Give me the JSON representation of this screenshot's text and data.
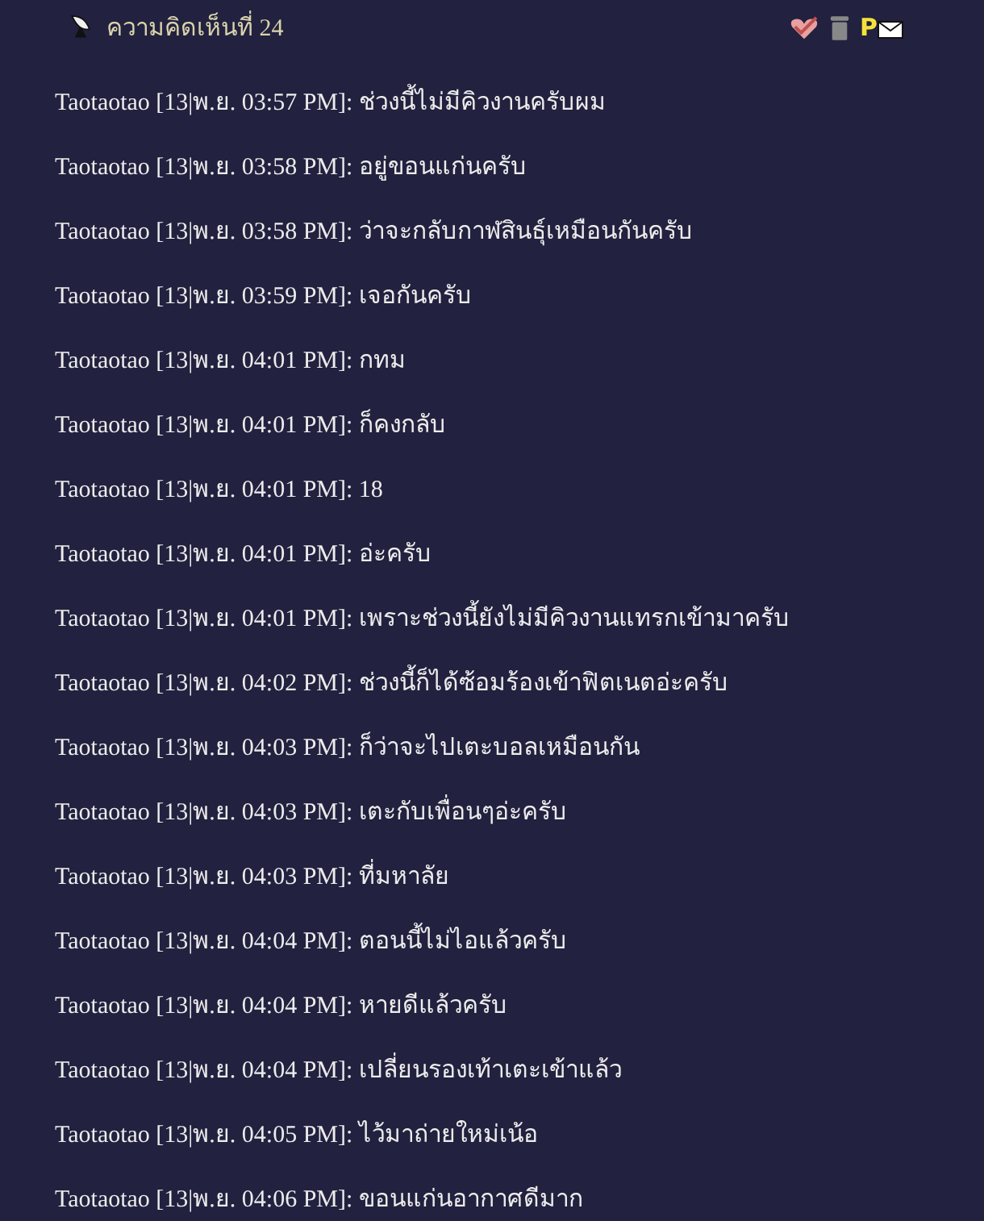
{
  "header": {
    "title": "ความคิดเห็นที่ 24",
    "pm_letter": "P"
  },
  "messages": [
    "Taotaotao [13|พ.ย. 03:57 PM]: ช่วงนี้ไม่มีคิวงานครับผม",
    "Taotaotao [13|พ.ย. 03:58 PM]: อยู่ขอนแก่นครับ",
    "Taotaotao [13|พ.ย. 03:58 PM]: ว่าจะกลับกาฬสินธุ์เหมือนกันครับ",
    "Taotaotao [13|พ.ย. 03:59 PM]: เจอกันครับ",
    "Taotaotao [13|พ.ย. 04:01 PM]: กทม",
    "Taotaotao [13|พ.ย. 04:01 PM]: ก็คงกลับ",
    "Taotaotao [13|พ.ย. 04:01 PM]: 18",
    "Taotaotao [13|พ.ย. 04:01 PM]: อ่ะครับ",
    "Taotaotao [13|พ.ย. 04:01 PM]: เพราะช่วงนี้ยังไม่มีคิวงานแทรกเข้ามาครับ",
    "Taotaotao [13|พ.ย. 04:02 PM]: ช่วงนี้ก็ได้ซ้อมร้องเข้าฟิตเนตอ่ะครับ",
    "Taotaotao [13|พ.ย. 04:03 PM]: ก็ว่าจะไปเตะบอลเหมือนกัน",
    "Taotaotao [13|พ.ย. 04:03 PM]: เตะกับเพื่อนๆอ่ะครับ",
    "Taotaotao [13|พ.ย. 04:03 PM]: ที่มหาลัย",
    "Taotaotao [13|พ.ย. 04:04 PM]: ตอนนี้ไม่ไอแล้วครับ",
    "Taotaotao [13|พ.ย. 04:04 PM]: หายดีแล้วครับ",
    "Taotaotao [13|พ.ย. 04:04 PM]: เปลี่ยนรองเท้าเตะเข้าแล้ว",
    "Taotaotao [13|พ.ย. 04:05 PM]: ไว้มาถ่ายใหม่เน้อ",
    "Taotaotao [13|พ.ย. 04:06 PM]: ขอนแก่นอากาศดีมาก"
  ]
}
